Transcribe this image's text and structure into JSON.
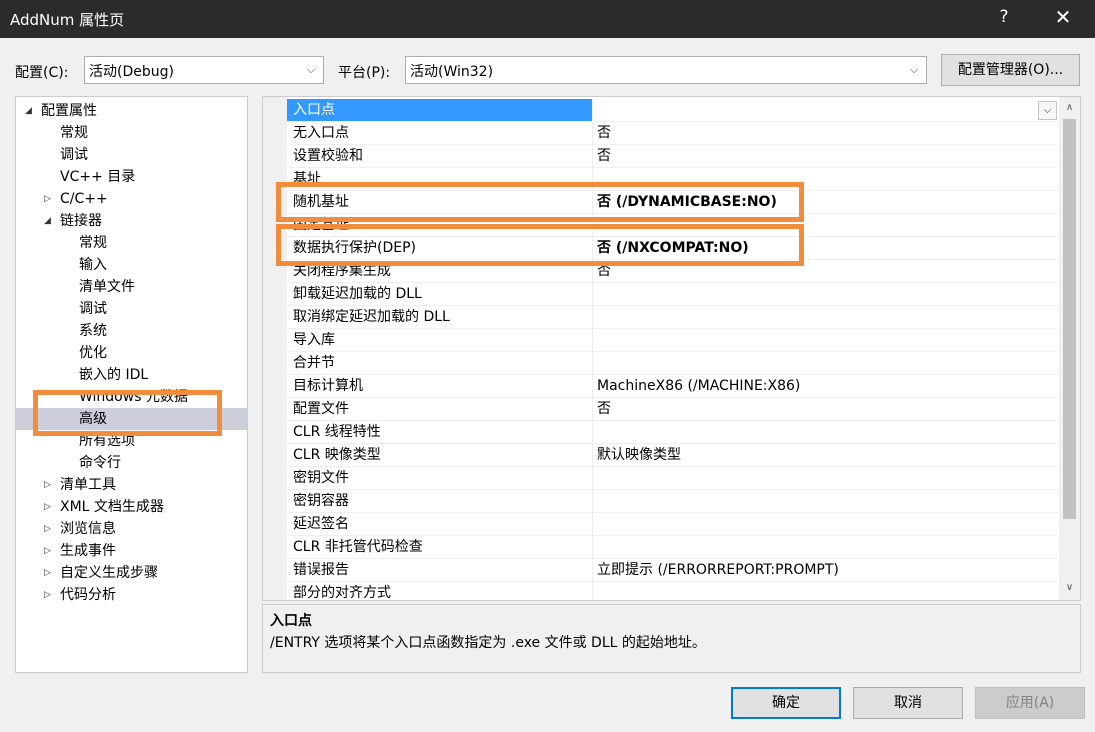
{
  "window": {
    "title": "AddNum 属性页",
    "help_label": "?",
    "close_label": "✕"
  },
  "config": {
    "label": "配置(C):",
    "value": "活动(Debug)",
    "platform_label": "平台(P):",
    "platform_value": "活动(Win32)",
    "manager_button": "配置管理器(O)..."
  },
  "tree": {
    "items": [
      {
        "label": "配置属性",
        "expander": "◢",
        "expanded": true
      },
      {
        "label": "常规"
      },
      {
        "label": "调试"
      },
      {
        "label": "VC++ 目录"
      },
      {
        "label": "C/C++",
        "expander": "▷"
      },
      {
        "label": "链接器",
        "expander": "◢",
        "expanded": true
      },
      {
        "label": "常规"
      },
      {
        "label": "输入"
      },
      {
        "label": "清单文件"
      },
      {
        "label": "调试"
      },
      {
        "label": "系统"
      },
      {
        "label": "优化"
      },
      {
        "label": "嵌入的 IDL"
      },
      {
        "label": "Windows 元数据"
      },
      {
        "label": "高级",
        "selected": true
      },
      {
        "label": "所有选项"
      },
      {
        "label": "命令行"
      },
      {
        "label": "清单工具",
        "expander": "▷"
      },
      {
        "label": "XML 文档生成器",
        "expander": "▷"
      },
      {
        "label": "浏览信息",
        "expander": "▷"
      },
      {
        "label": "生成事件",
        "expander": "▷"
      },
      {
        "label": "自定义生成步骤",
        "expander": "▷"
      },
      {
        "label": "代码分析",
        "expander": "▷"
      }
    ]
  },
  "grid": {
    "rows": [
      {
        "name": "入口点",
        "value": "",
        "selected": true
      },
      {
        "name": "无入口点",
        "value": "否"
      },
      {
        "name": "设置校验和",
        "value": "否"
      },
      {
        "name": "基址",
        "value": ""
      },
      {
        "name": "随机基址",
        "value": "否 (/DYNAMICBASE:NO)",
        "bold": true
      },
      {
        "name": "固定基址",
        "value": ""
      },
      {
        "name": "数据执行保护(DEP)",
        "value": "否 (/NXCOMPAT:NO)",
        "bold": true
      },
      {
        "name": "关闭程序集生成",
        "value": "否"
      },
      {
        "name": "卸载延迟加载的 DLL",
        "value": ""
      },
      {
        "name": "取消绑定延迟加载的 DLL",
        "value": ""
      },
      {
        "name": "导入库",
        "value": ""
      },
      {
        "name": "合并节",
        "value": ""
      },
      {
        "name": "目标计算机",
        "value": "MachineX86 (/MACHINE:X86)"
      },
      {
        "name": "配置文件",
        "value": "否"
      },
      {
        "name": "CLR 线程特性",
        "value": ""
      },
      {
        "name": "CLR 映像类型",
        "value": "默认映像类型"
      },
      {
        "name": "密钥文件",
        "value": ""
      },
      {
        "name": "密钥容器",
        "value": ""
      },
      {
        "name": "延迟签名",
        "value": ""
      },
      {
        "name": "CLR 非托管代码检查",
        "value": ""
      },
      {
        "name": "错误报告",
        "value": "立即提示 (/ERRORREPORT:PROMPT)"
      },
      {
        "name": "部分的对齐方式",
        "value": ""
      }
    ]
  },
  "description": {
    "title": "入口点",
    "text": "/ENTRY 选项将某个入口点函数指定为 .exe 文件或 DLL 的起始地址。"
  },
  "buttons": {
    "ok": "确定",
    "cancel": "取消",
    "apply": "应用(A)"
  },
  "colors": {
    "highlight": "#f08c3c",
    "selection": "#3399ff",
    "titlebar": "#2b2b2b"
  }
}
